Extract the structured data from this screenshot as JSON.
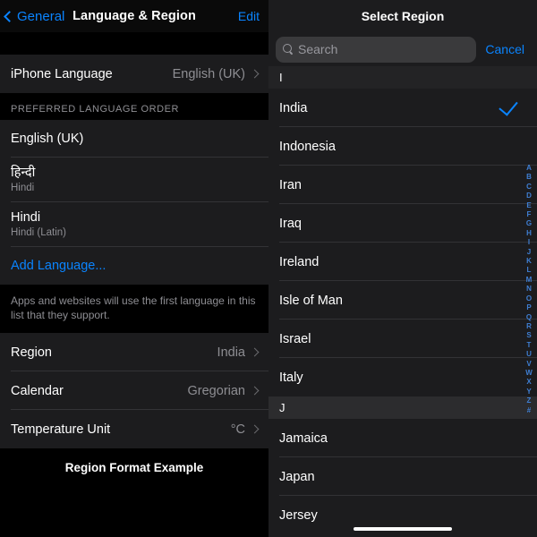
{
  "left_panel": {
    "navbar": {
      "back_label": "General",
      "title": "Language & Region",
      "edit_label": "Edit"
    },
    "language_row": {
      "title": "iPhone Language",
      "value": "English (UK)"
    },
    "preferred_section": {
      "header": "PREFERRED LANGUAGE ORDER",
      "items": [
        {
          "main": "English (UK)",
          "sub": ""
        },
        {
          "main": "हिन्दी",
          "sub": "Hindi"
        },
        {
          "main": "Hindi",
          "sub": "Hindi (Latin)"
        }
      ],
      "add_language_label": "Add Language...",
      "footer": "Apps and websites will use the first language in this list that they support."
    },
    "region_section": {
      "rows": [
        {
          "title": "Region",
          "value": "India"
        },
        {
          "title": "Calendar",
          "value": "Gregorian"
        },
        {
          "title": "Temperature Unit",
          "value": "°C"
        }
      ]
    },
    "format_example_header": "Region Format Example"
  },
  "right_panel": {
    "title": "Select Region",
    "search": {
      "placeholder": "Search",
      "value": ""
    },
    "cancel_label": "Cancel",
    "sections": [
      {
        "letter": "I",
        "highlighted": false,
        "items": [
          {
            "name": "India",
            "selected": true
          },
          {
            "name": "Indonesia",
            "selected": false
          },
          {
            "name": "Iran",
            "selected": false
          },
          {
            "name": "Iraq",
            "selected": false
          },
          {
            "name": "Ireland",
            "selected": false
          },
          {
            "name": "Isle of Man",
            "selected": false
          },
          {
            "name": "Israel",
            "selected": false
          },
          {
            "name": "Italy",
            "selected": false
          }
        ]
      },
      {
        "letter": "J",
        "highlighted": true,
        "items": [
          {
            "name": "Jamaica",
            "selected": false
          },
          {
            "name": "Japan",
            "selected": false
          },
          {
            "name": "Jersey",
            "selected": false
          }
        ]
      }
    ],
    "alphabet_index": [
      "A",
      "B",
      "C",
      "D",
      "E",
      "F",
      "G",
      "H",
      "I",
      "J",
      "K",
      "L",
      "M",
      "N",
      "O",
      "P",
      "Q",
      "R",
      "S",
      "T",
      "U",
      "V",
      "W",
      "X",
      "Y",
      "Z",
      "#"
    ]
  },
  "colors": {
    "accent_blue": "#0A84FF",
    "index_blue": "#3F7FD4",
    "row_bg": "#1C1C1E",
    "page_bg": "#000000",
    "secondary_text": "#8E8E93"
  }
}
